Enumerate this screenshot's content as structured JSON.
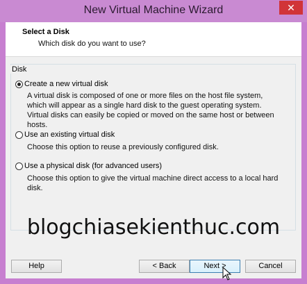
{
  "window": {
    "title": "New Virtual Machine Wizard",
    "close_glyph": "✕"
  },
  "header": {
    "title": "Select a Disk",
    "subtitle": "Which disk do you want to use?"
  },
  "group": {
    "legend": "Disk",
    "options": [
      {
        "label": "Create a new virtual disk",
        "selected": true,
        "description": "A virtual disk is composed of one or more files on the host file system, which will appear as a single hard disk to the guest operating system. Virtual disks can easily be copied or moved on the same host or between hosts."
      },
      {
        "label": "Use an existing virtual disk",
        "selected": false,
        "description": "Choose this option to reuse a previously configured disk."
      },
      {
        "label": "Use a physical disk (for advanced users)",
        "selected": false,
        "description": "Choose this option to give the virtual machine direct access to a local hard disk."
      }
    ]
  },
  "watermark": "blogchiasekienthuc.com",
  "buttons": {
    "help": "Help",
    "back": "< Back",
    "next": "Next >",
    "cancel": "Cancel"
  },
  "colors": {
    "frame": "#c77fd0",
    "close": "#d13438"
  }
}
